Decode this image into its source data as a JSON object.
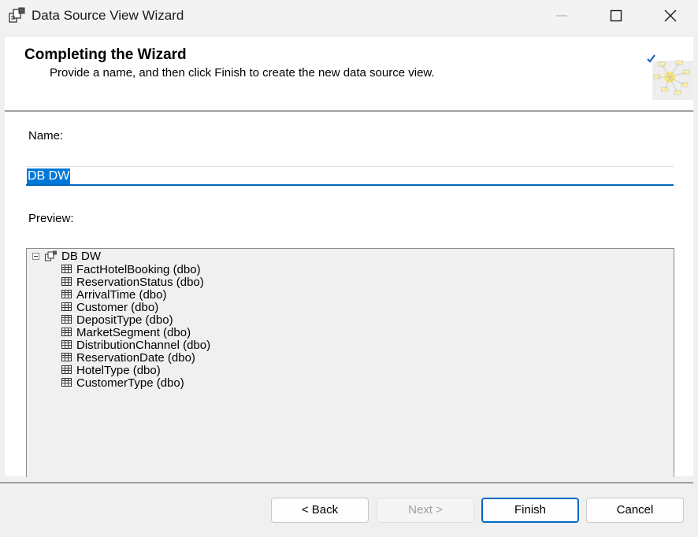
{
  "window": {
    "title": "Data Source View Wizard"
  },
  "header": {
    "title": "Completing the Wizard",
    "subtitle": "Provide a name, and then click Finish to create the new data source view."
  },
  "form": {
    "name_label": "Name:",
    "name_value": "DB DW",
    "preview_label": "Preview:"
  },
  "tree": {
    "root": "DB DW",
    "items": [
      {
        "label": "FactHotelBooking (dbo)"
      },
      {
        "label": "ReservationStatus (dbo)"
      },
      {
        "label": "ArrivalTime (dbo)"
      },
      {
        "label": "Customer (dbo)"
      },
      {
        "label": "DepositType (dbo)"
      },
      {
        "label": "MarketSegment (dbo)"
      },
      {
        "label": "DistributionChannel (dbo)"
      },
      {
        "label": "ReservationDate (dbo)"
      },
      {
        "label": "HotelType (dbo)"
      },
      {
        "label": "CustomerType (dbo)"
      }
    ]
  },
  "buttons": {
    "back": "< Back",
    "next": "Next >",
    "finish": "Finish",
    "cancel": "Cancel"
  },
  "icons": {
    "app": "data-source-view-icon",
    "root": "data-source-view-icon",
    "table": "table-icon",
    "wizard": "wizard-graphic"
  },
  "colors": {
    "selection": "#0078d7",
    "accent": "#0067c0",
    "panel": "#f0f0f0"
  }
}
